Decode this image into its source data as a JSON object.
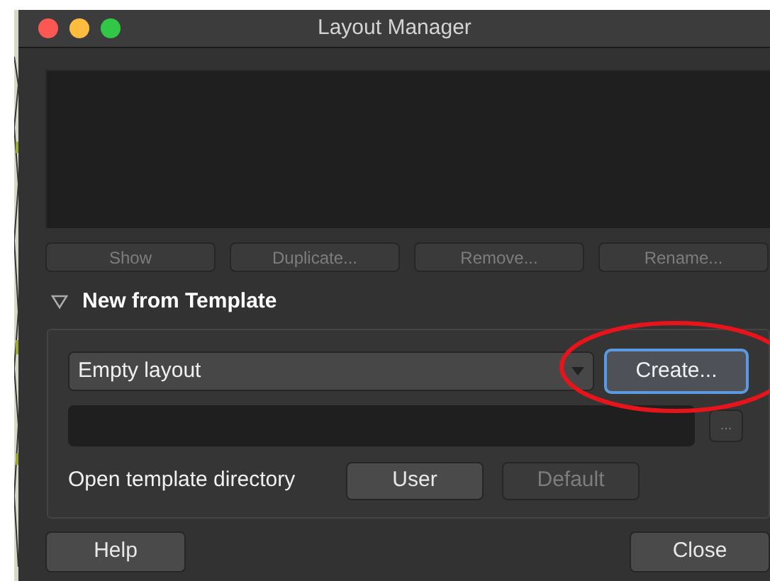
{
  "window": {
    "title": "Layout Manager"
  },
  "list_buttons": [
    {
      "label": "Show",
      "disabled": true
    },
    {
      "label": "Duplicate...",
      "disabled": true
    },
    {
      "label": "Remove...",
      "disabled": true
    },
    {
      "label": "Rename...",
      "disabled": true
    }
  ],
  "template_section": {
    "title": "New from Template",
    "expanded": true,
    "template_select": {
      "value": "Empty layout"
    },
    "create_button": {
      "label": "Create...",
      "focused": true
    },
    "browse_button": {
      "label": "...",
      "disabled": true
    },
    "directory_label": "Open template directory",
    "directory_buttons": [
      {
        "label": "User",
        "disabled": false
      },
      {
        "label": "Default",
        "disabled": true
      }
    ]
  },
  "footer_buttons": [
    "Help",
    "Close"
  ]
}
